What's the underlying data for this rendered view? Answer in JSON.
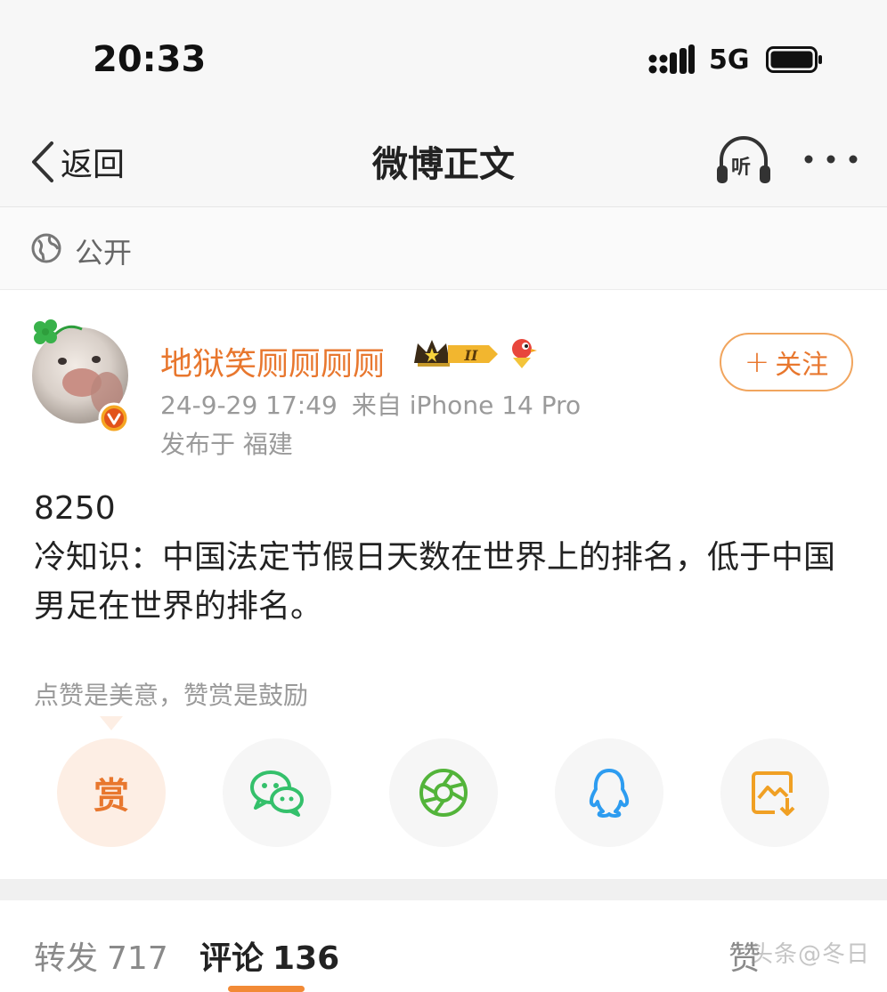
{
  "status_bar": {
    "time": "20:33",
    "network": "5G"
  },
  "nav": {
    "back_label": "返回",
    "title": "微博正文",
    "listen_label": "听"
  },
  "visibility": {
    "label": "公开",
    "icon": "globe-icon"
  },
  "author": {
    "name": "地狱笑厕厕厕厕",
    "badge_level": "II",
    "timestamp": "24-9-29 17:49",
    "source": "来自 iPhone 14 Pro",
    "location": "发布于 福建",
    "follow_label": "关注",
    "follow_plus": "+"
  },
  "post": {
    "number": "8250",
    "text": "冷知识：中国法定节假日天数在世界上的排名，低于中国男足在世界的排名。"
  },
  "reward": {
    "hint": "点赞是美意，赞赏是鼓励",
    "button_label": "赏"
  },
  "share": {
    "items": [
      {
        "name": "reward",
        "icon": "reward-icon"
      },
      {
        "name": "wechat",
        "icon": "wechat-icon"
      },
      {
        "name": "moments",
        "icon": "moments-icon"
      },
      {
        "name": "qq",
        "icon": "qq-icon"
      },
      {
        "name": "save-image",
        "icon": "save-image-icon"
      }
    ]
  },
  "tabs": {
    "repost": {
      "label": "转发",
      "count": "717"
    },
    "comment": {
      "label": "评论",
      "count": "136"
    },
    "like": {
      "label": "赞"
    }
  },
  "watermark": "头条@冬日"
}
